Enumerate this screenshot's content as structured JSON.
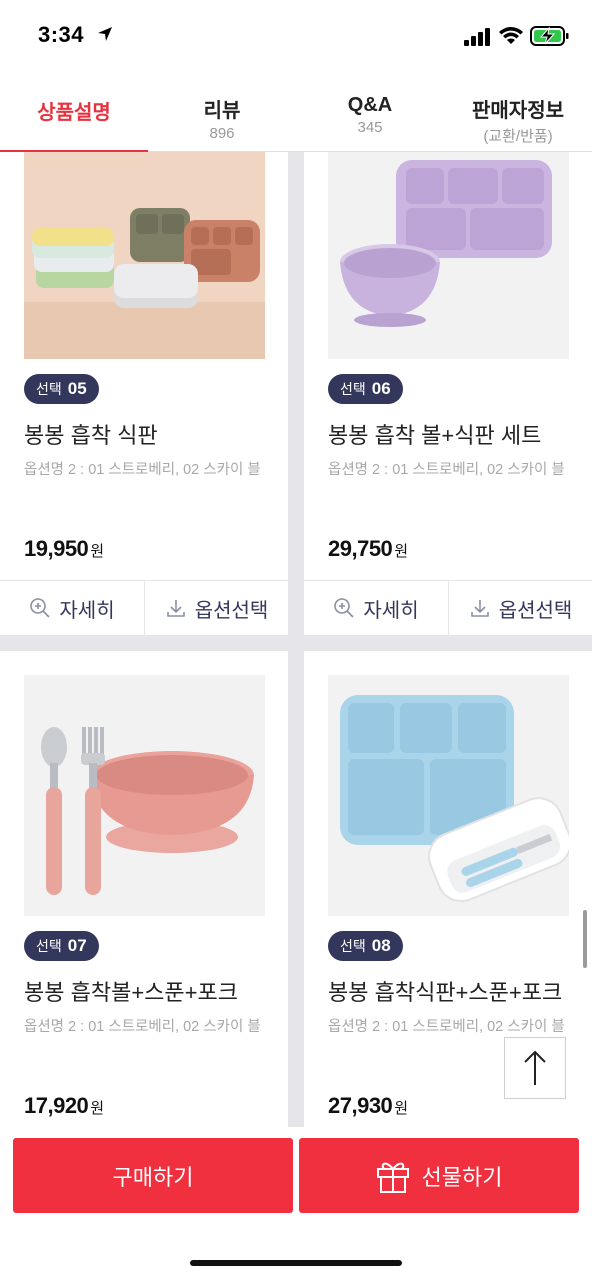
{
  "status": {
    "time": "3:34"
  },
  "tabs": [
    {
      "label": "상품설명",
      "sub": ""
    },
    {
      "label": "리뷰",
      "sub": "896"
    },
    {
      "label": "Q&A",
      "sub": "345"
    },
    {
      "label": "판매자정보",
      "sub": "(교환/반품)"
    }
  ],
  "products": [
    {
      "badge_prefix": "선택",
      "badge_num": "05",
      "name": "봉봉 흡착 식판",
      "option": "옵션명 2 : 01 스트로베리, 02 스카이 블",
      "price": "19,950",
      "unit": "원"
    },
    {
      "badge_prefix": "선택",
      "badge_num": "06",
      "name": "봉봉 흡착 볼+식판 세트",
      "option": "옵션명 2 : 01 스트로베리, 02 스카이 블",
      "price": "29,750",
      "unit": "원"
    },
    {
      "badge_prefix": "선택",
      "badge_num": "07",
      "name": "봉봉 흡착볼+스푼+포크",
      "option": "옵션명 2 : 01 스트로베리, 02 스카이 블",
      "price": "17,920",
      "unit": "원"
    },
    {
      "badge_prefix": "선택",
      "badge_num": "08",
      "name": "봉봉 흡착식판+스푼+포크",
      "option": "옵션명 2 : 01 스트로베리, 02 스카이 블",
      "price": "27,930",
      "unit": "원"
    }
  ],
  "actions": {
    "detail": "자세히",
    "option": "옵션선택"
  },
  "bottom": {
    "buy": "구매하기",
    "gift": "선물하기"
  },
  "colors": {
    "accent": "#f0303e",
    "navy": "#33375b"
  }
}
